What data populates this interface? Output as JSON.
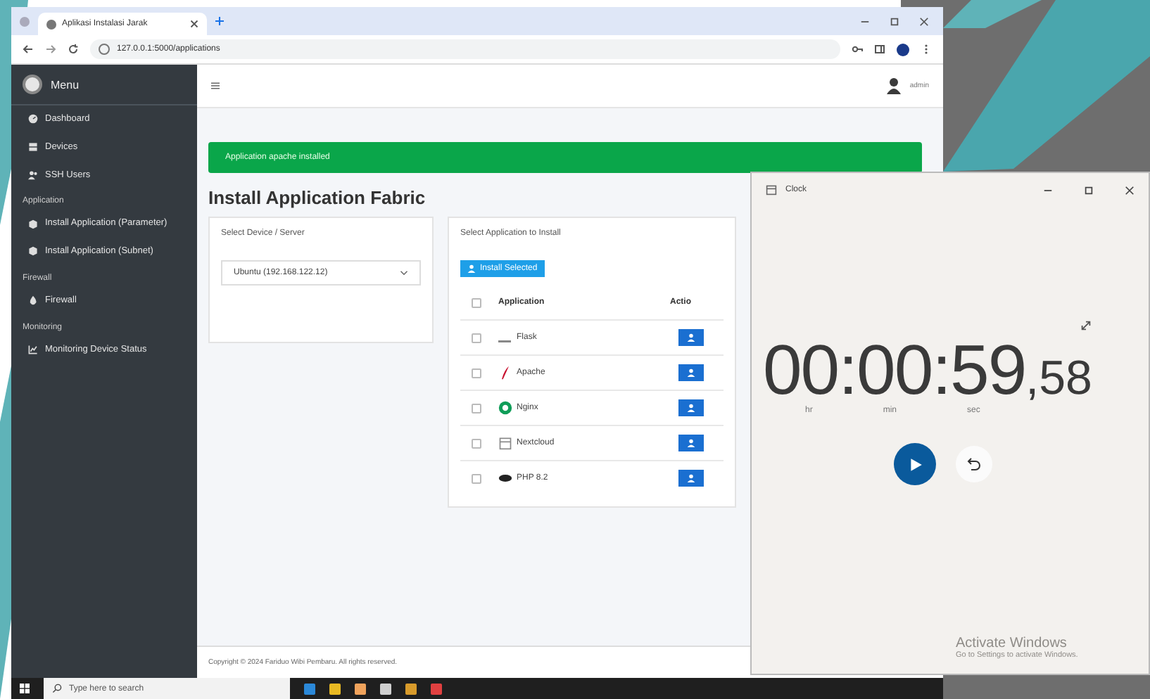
{
  "browser": {
    "tab_title": "Aplikasi Instalasi Jarak",
    "url": "127.0.0.1:5000/applications"
  },
  "sidebar": {
    "brand": "Menu",
    "groups": [
      {
        "items": [
          {
            "label": "Dashboard"
          },
          {
            "label": "Devices"
          },
          {
            "label": "SSH Users"
          }
        ]
      },
      {
        "heading": "Application",
        "items": [
          {
            "label": "Install Application (Parameter)"
          },
          {
            "label": "Install Application (Subnet)"
          }
        ]
      },
      {
        "heading": "Firewall",
        "items": [
          {
            "label": "Firewall"
          }
        ]
      },
      {
        "heading": "Monitoring",
        "items": [
          {
            "label": "Monitoring Device Status"
          }
        ]
      }
    ]
  },
  "header": {
    "user": "admin"
  },
  "alert": "Application apache installed",
  "page_title": "Install Application Fabric",
  "device_card": {
    "label": "Select Device / Server",
    "select_value": "Ubuntu (192.168.122.12)"
  },
  "app_card": {
    "label": "Select Application to Install",
    "install_button": "Install Selected",
    "all_checked": false,
    "columns": [
      "Application",
      "Actio"
    ],
    "rows": [
      {
        "name": "Flask",
        "checked": false
      },
      {
        "name": "Apache",
        "checked": false
      },
      {
        "name": "Nginx",
        "checked": false
      },
      {
        "name": "Nextcloud",
        "checked": false
      },
      {
        "name": "PHP 8.2",
        "checked": false
      }
    ]
  },
  "footer": "Copyright © 2024 Fariduo Wibi Pembaru. All rights reserved.",
  "clock": {
    "title": "Clock",
    "time": "00:00:59",
    "fraction": ",58",
    "units": [
      "hr",
      "min",
      "sec"
    ]
  },
  "activation": {
    "title": "Activate Windows",
    "subtitle": "Go to Settings to activate Windows."
  },
  "taskbar": {
    "search_placeholder": "Type here to search"
  }
}
